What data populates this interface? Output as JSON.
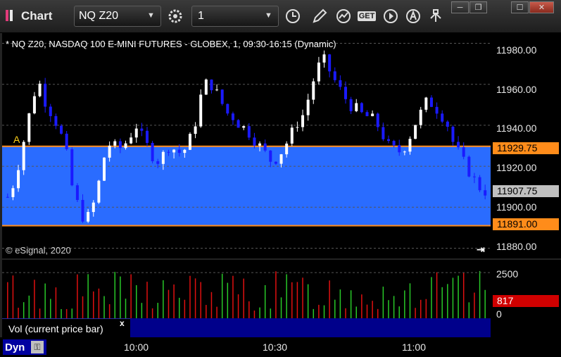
{
  "window": {
    "title": "Chart",
    "symbol": "NQ Z20",
    "interval": "1",
    "minimize_label": "─",
    "restore_label": "❐",
    "maximize_label": "☐",
    "close_label": "✕"
  },
  "toolbar": {
    "get_label": "GET",
    "icons": [
      "settings-gear-icon",
      "clock-icon",
      "pencil-icon",
      "indicator-chart-icon",
      "get-data-icon",
      "play-icon",
      "alert-icon",
      "link-icon"
    ]
  },
  "chart": {
    "header": "* NQ Z20, NASDAQ 100 E-MINI FUTURES - GLOBEX, 1, 09:30-16:15 (Dynamic)",
    "copyright": "© eSignal, 2020",
    "marker_label": "A",
    "price_ticks": [
      "11980.00",
      "11960.00",
      "11940.00",
      "11920.00",
      "11900.00",
      "11880.00"
    ],
    "level_high": "11929.75",
    "level_low": "11891.00",
    "last_price": "11907.75",
    "colors": {
      "up": "#ffffff",
      "down": "#1a1aff",
      "band": "#2a6cff",
      "level": "#ff8c1a",
      "last": "#c0c0c0"
    }
  },
  "chart_data": {
    "type": "candlestick",
    "title": "* NQ Z20, NASDAQ 100 E-MINI FUTURES - GLOBEX, 1, 09:30-16:15 (Dynamic)",
    "ylim": [
      11875,
      11985
    ],
    "y_ticks": [
      11880,
      11900,
      11920,
      11940,
      11960,
      11980
    ],
    "x_ticks": [
      "10:00",
      "10:30",
      "11:00"
    ],
    "bars": 90,
    "last": 11907.75,
    "levels": [
      11929.75,
      11891.0
    ],
    "close_path": [
      11905,
      11912,
      11925,
      11940,
      11955,
      11960,
      11950,
      11945,
      11938,
      11928,
      11910,
      11900,
      11893,
      11898,
      11910,
      11925,
      11932,
      11928,
      11930,
      11935,
      11940,
      11933,
      11928,
      11922,
      11925,
      11930,
      11928,
      11926,
      11931,
      11940,
      11955,
      11962,
      11958,
      11952,
      11946,
      11944,
      11940,
      11938,
      11934,
      11930,
      11926,
      11922,
      11925,
      11930,
      11936,
      11942,
      11946,
      11958,
      11968,
      11972,
      11966,
      11960,
      11955,
      11950,
      11948,
      11945,
      11944,
      11942,
      11936,
      11930,
      11928,
      11927,
      11932,
      11940,
      11946,
      11952,
      11950,
      11946,
      11942,
      11932,
      11926,
      11920,
      11915,
      11910,
      11907.75
    ],
    "volume_ticks": [
      2500,
      0
    ],
    "volume_last": 817
  },
  "volume": {
    "label": "Vol (current price bar)",
    "close_label": "x",
    "ticks": [
      "2500",
      "0"
    ],
    "last": "817"
  },
  "time_axis": {
    "mode": "Dyn",
    "labels": [
      "10:00",
      "10:30",
      "11:00"
    ]
  }
}
